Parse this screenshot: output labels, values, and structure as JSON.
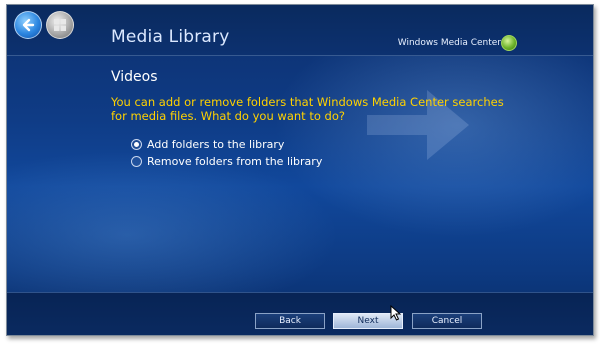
{
  "header": {
    "title": "Media Library",
    "brand": "Windows Media Center",
    "back_icon": "back-arrow-icon",
    "start_icon": "windows-start-icon"
  },
  "main": {
    "section_title": "Videos",
    "question": "You can add or remove folders that Windows Media Center searches for media files. What do you want to do?",
    "options": [
      {
        "label": "Add folders to the library",
        "selected": true
      },
      {
        "label": "Remove folders from the library",
        "selected": false
      }
    ]
  },
  "footer": {
    "back_label": "Back",
    "next_label": "Next",
    "cancel_label": "Cancel"
  },
  "colors": {
    "background": "#0f3c86",
    "question_text": "#ffd200",
    "focus_button": "#dfe8f6"
  }
}
